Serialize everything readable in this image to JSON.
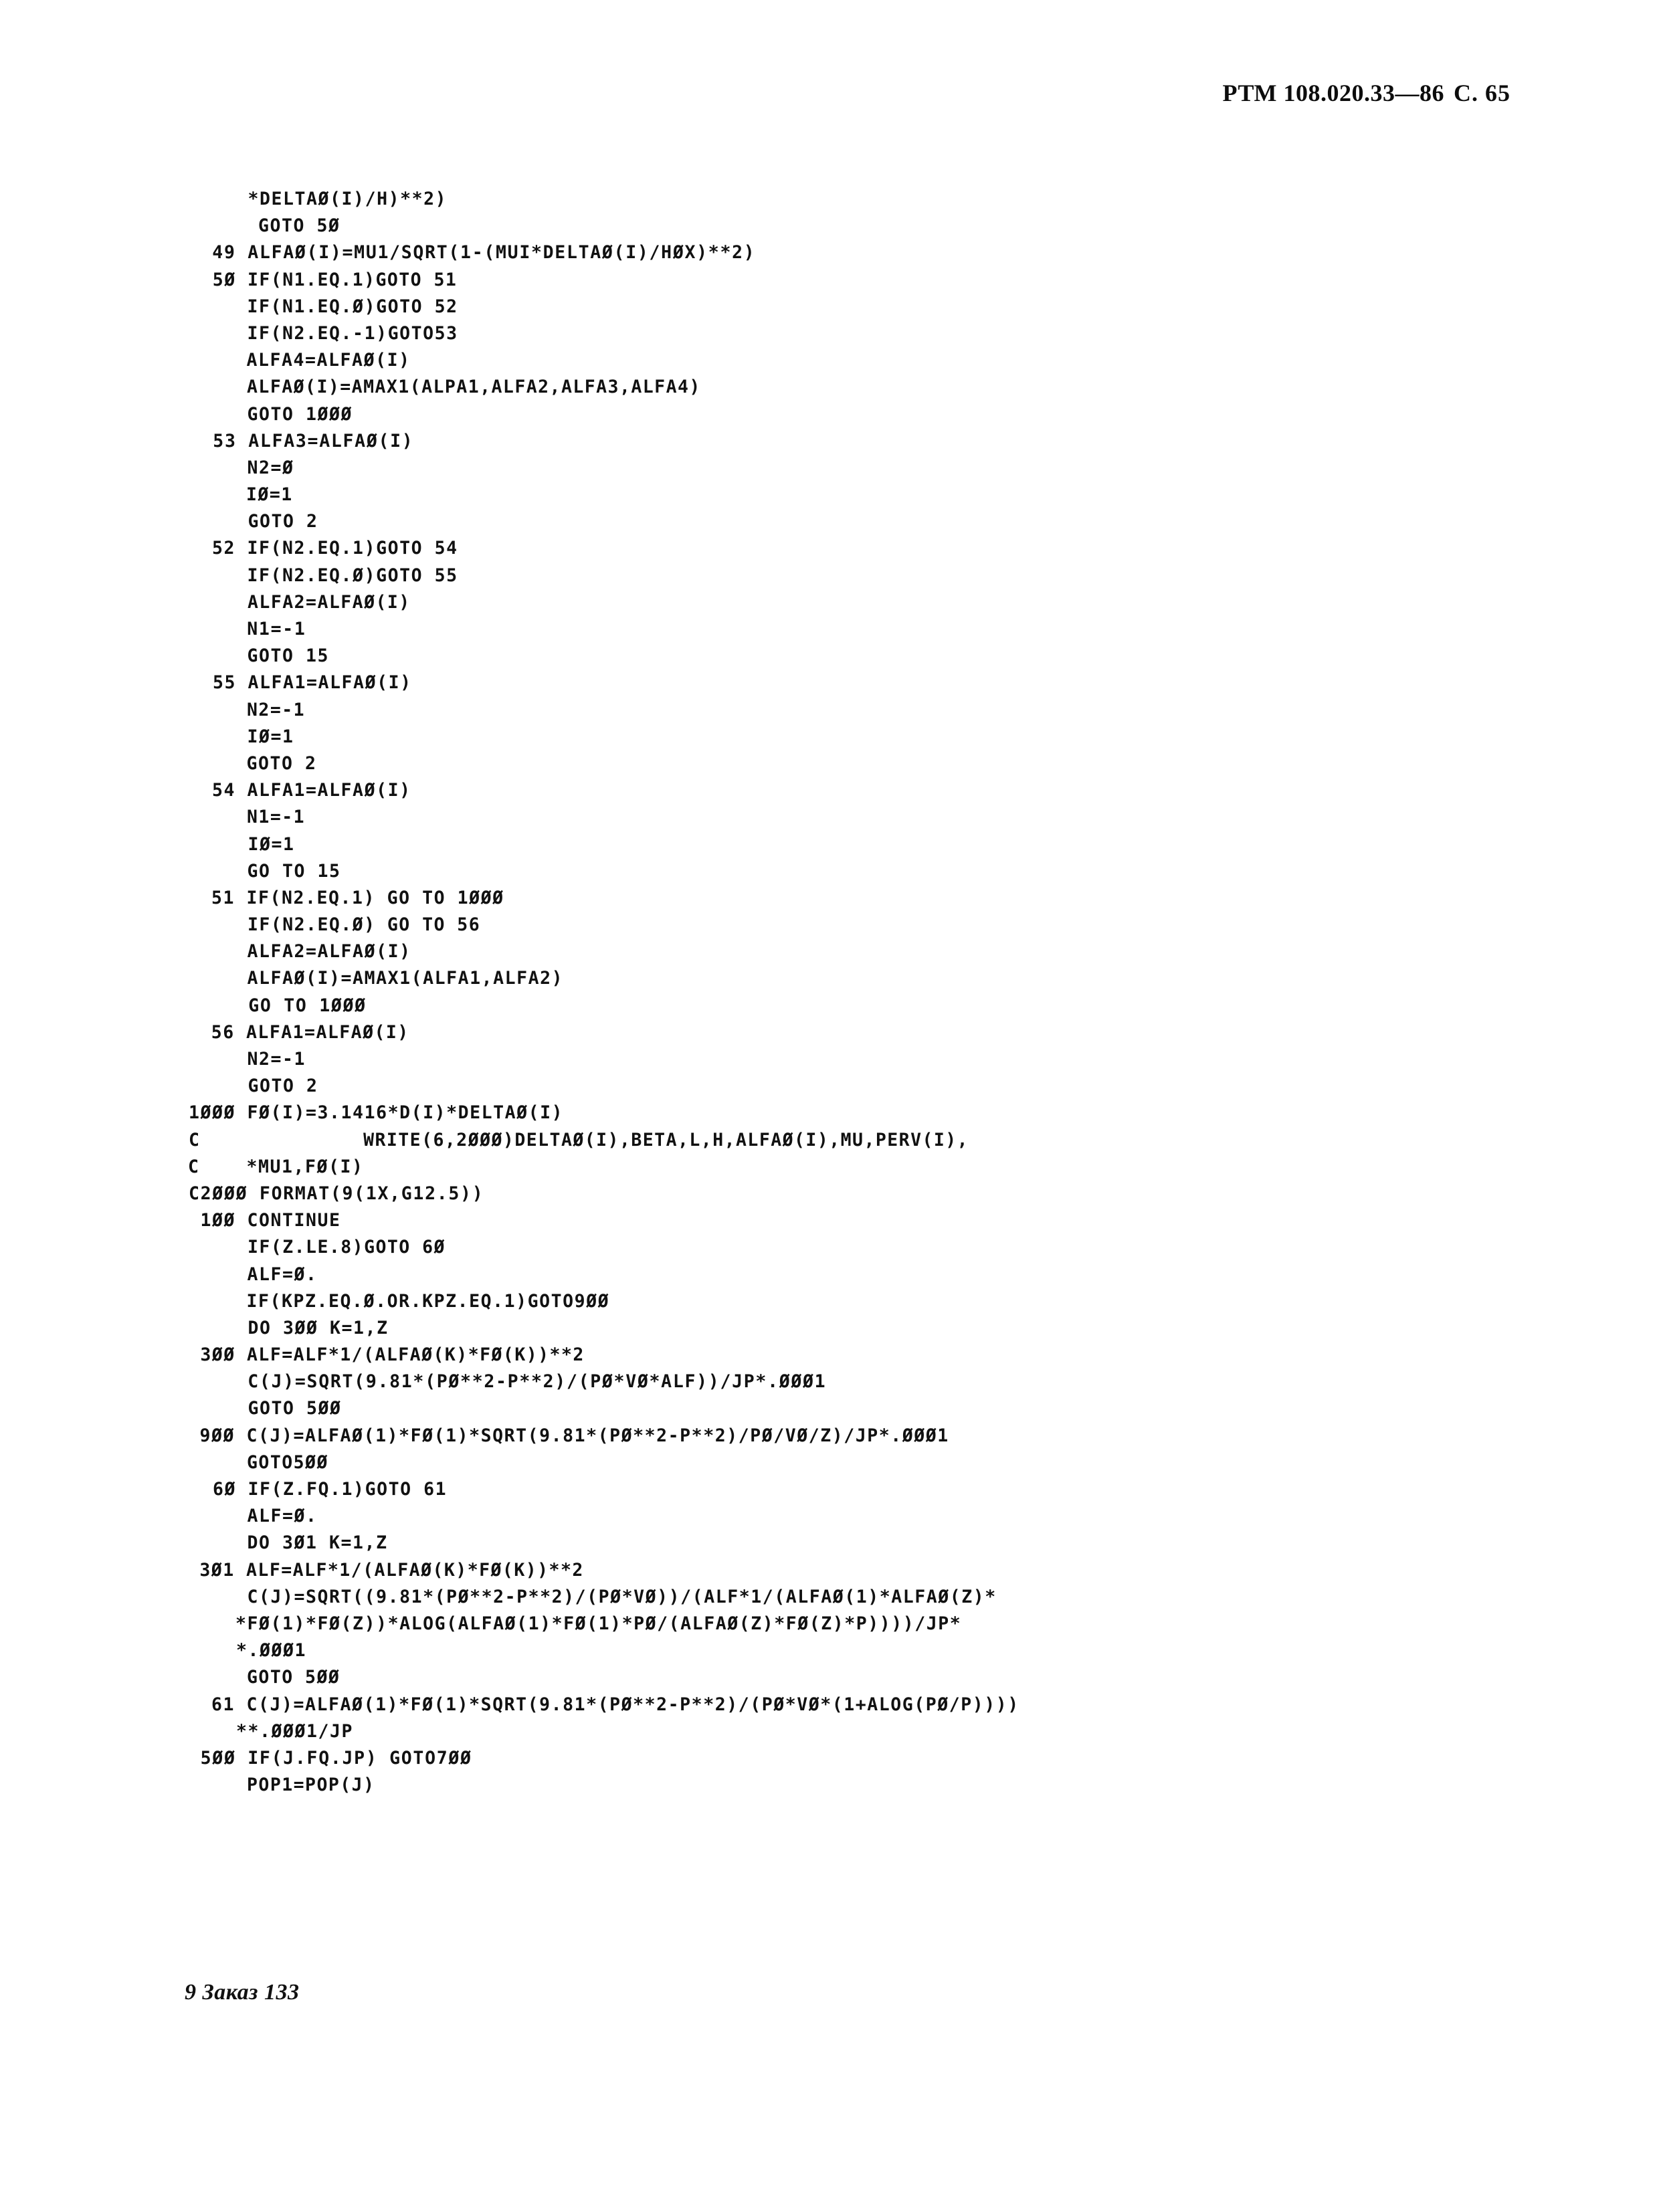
{
  "page": {
    "document_number": "РТМ 108.020.33—86",
    "page_label": "С. 65",
    "footer": "9 Заказ 133"
  },
  "listing": {
    "language": "FORTRAN",
    "lines": [
      "     *DELTAØ(I)/H)**2)",
      "      GOTO 5Ø",
      "  49 ALFAØ(I)=MU1/SQRT(1-(MUI*DELTAØ(I)/HØX)**2)",
      "  5Ø IF(N1.EQ.1)GOTO 51",
      "     IF(N1.EQ.Ø)GOTO 52",
      "     IF(N2.EQ.-1)GOTO53",
      "     ALFA4=ALFAØ(I)",
      "     ALFAØ(I)=AMAX1(ALPA1,ALFA2,ALFA3,ALFA4)",
      "     GOTO 1ØØØ",
      "  53 ALFA3=ALFAØ(I)",
      "     N2=Ø",
      "     IØ=1",
      "     GOTO 2",
      "  52 IF(N2.EQ.1)GOTO 54",
      "     IF(N2.EQ.Ø)GOTO 55",
      "     ALFA2=ALFAØ(I)",
      "     N1=-1",
      "     GOTO 15",
      "  55 ALFA1=ALFAØ(I)",
      "     N2=-1",
      "     IØ=1",
      "     GOTO 2",
      "  54 ALFA1=ALFAØ(I)",
      "     N1=-1",
      "     IØ=1",
      "     GO TO 15",
      "  51 IF(N2.EQ.1) GO TO 1ØØØ",
      "     IF(N2.EQ.Ø) GO TO 56",
      "     ALFA2=ALFAØ(I)",
      "     ALFAØ(I)=AMAX1(ALFA1,ALFA2)",
      "     GO TO 1ØØØ",
      "  56 ALFA1=ALFAØ(I)",
      "     N2=-1",
      "     GOTO 2",
      "1ØØØ FØ(I)=3.1416*D(I)*DELTAØ(I)",
      "C              WRITE(6,2ØØØ)DELTAØ(I),BETA,L,H,ALFAØ(I),MU,PERV(I),",
      "C    *MU1,FØ(I)",
      "C2ØØØ FORMAT(9(1X,G12.5))",
      " 1ØØ CONTINUE",
      "     IF(Z.LE.8)GOTO 6Ø",
      "     ALF=Ø.",
      "     IF(KPZ.EQ.Ø.OR.KPZ.EQ.1)GOTO9ØØ",
      "     DO 3ØØ K=1,Z",
      " 3ØØ ALF=ALF*1/(ALFAØ(K)*FØ(K))**2",
      "     C(J)=SQRT(9.81*(PØ**2-P**2)/(PØ*VØ*ALF))/JP*.ØØØ1",
      "     GOTO 5ØØ",
      " 9ØØ C(J)=ALFAØ(1)*FØ(1)*SQRT(9.81*(PØ**2-P**2)/PØ/VØ/Z)/JP*.ØØØ1",
      "     GOTO5ØØ",
      "  6Ø IF(Z.FQ.1)GOTO 61",
      "     ALF=Ø.",
      "     DO 3Ø1 K=1,Z",
      " 3Ø1 ALF=ALF*1/(ALFAØ(K)*FØ(K))**2",
      "     C(J)=SQRT((9.81*(PØ**2-P**2)/(PØ*VØ))/(ALF*1/(ALFAØ(1)*ALFAØ(Z)*",
      "    *FØ(1)*FØ(Z))*ALOG(ALFAØ(1)*FØ(1)*PØ/(ALFAØ(Z)*FØ(Z)*P))))/JP*",
      "    *.ØØØ1",
      "     GOTO 5ØØ",
      "  61 C(J)=ALFAØ(1)*FØ(1)*SQRT(9.81*(PØ**2-P**2)/(PØ*VØ*(1+ALOG(PØ/P))))",
      "    **.ØØØ1/JP",
      " 5ØØ IF(J.FQ.JP) GOTO7ØØ",
      "     POP1=POP(J)"
    ]
  }
}
